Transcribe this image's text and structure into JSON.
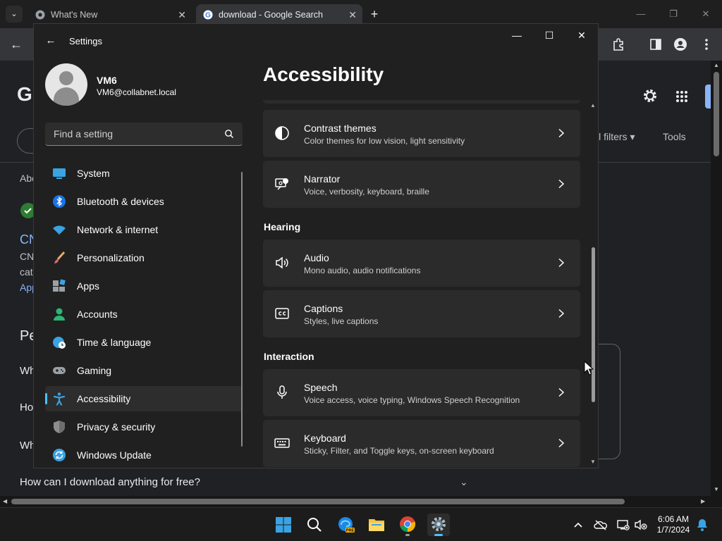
{
  "browser": {
    "tabs": [
      {
        "title": "What's New",
        "close": "✕"
      },
      {
        "title": "download - Google Search",
        "close": "✕"
      }
    ],
    "new_tab": "+",
    "window_controls": {
      "minimize": "—",
      "restore": "❐",
      "close": "✕"
    }
  },
  "google": {
    "logo_letter": "G",
    "filters_label": "ll filters ▾",
    "tools_label": "Tools",
    "peek_lines": [
      "Abc",
      "CN",
      "CN",
      "cat",
      "App",
      "Pe",
      "Wh",
      "Ho",
      "Wh"
    ],
    "faq_question": "How can I download anything for free?",
    "faq_chevron": "⌄"
  },
  "settings": {
    "app_title": "Settings",
    "window_controls": {
      "minimize": "—",
      "maximize": "☐",
      "close": "✕"
    },
    "user": {
      "name": "VM6",
      "email": "VM6@collabnet.local"
    },
    "search": {
      "placeholder": "Find a setting"
    },
    "nav": [
      {
        "label": "System",
        "icon": "system-icon",
        "active": false
      },
      {
        "label": "Bluetooth & devices",
        "icon": "bluetooth-icon",
        "active": false
      },
      {
        "label": "Network & internet",
        "icon": "wifi-icon",
        "active": false
      },
      {
        "label": "Personalization",
        "icon": "brush-icon",
        "active": false
      },
      {
        "label": "Apps",
        "icon": "apps-icon",
        "active": false
      },
      {
        "label": "Accounts",
        "icon": "accounts-icon",
        "active": false
      },
      {
        "label": "Time & language",
        "icon": "globe-clock-icon",
        "active": false
      },
      {
        "label": "Gaming",
        "icon": "gamepad-icon",
        "active": false
      },
      {
        "label": "Accessibility",
        "icon": "accessibility-icon",
        "active": true
      },
      {
        "label": "Privacy & security",
        "icon": "shield-icon",
        "active": false
      },
      {
        "label": "Windows Update",
        "icon": "update-icon",
        "active": false
      }
    ],
    "page_title": "Accessibility",
    "sections": {
      "hearing": "Hearing",
      "interaction": "Interaction"
    },
    "cards": [
      {
        "title": "Contrast themes",
        "desc": "Color themes for low vision, light sensitivity",
        "icon": "contrast-icon"
      },
      {
        "title": "Narrator",
        "desc": "Voice, verbosity, keyboard, braille",
        "icon": "narrator-icon"
      },
      {
        "title": "Audio",
        "desc": "Mono audio, audio notifications",
        "icon": "speaker-icon"
      },
      {
        "title": "Captions",
        "desc": "Styles, live captions",
        "icon": "captions-icon"
      },
      {
        "title": "Speech",
        "desc": "Voice access, voice typing, Windows Speech Recognition",
        "icon": "microphone-icon"
      },
      {
        "title": "Keyboard",
        "desc": "Sticky, Filter, and Toggle keys, on-screen keyboard",
        "icon": "keyboard-icon"
      }
    ]
  },
  "taskbar": {
    "apps": [
      "start-icon",
      "search-icon",
      "edge-pre-icon",
      "file-explorer-icon",
      "chrome-icon",
      "settings-icon"
    ],
    "clock": {
      "time": "6:06 AM",
      "date": "1/7/2024"
    }
  },
  "colors": {
    "accent": "#4cc2ff",
    "settings_bg": "#202020",
    "card_bg": "#2b2b2b",
    "chrome_bg": "#202124"
  }
}
